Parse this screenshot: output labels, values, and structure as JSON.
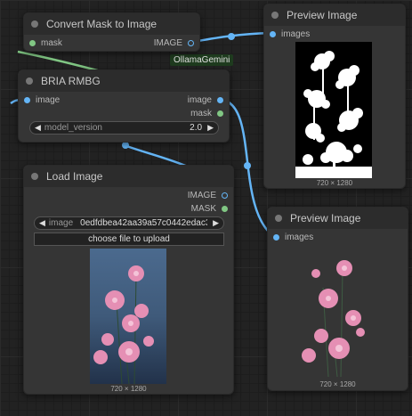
{
  "colors": {
    "image_link": "#64b5f6",
    "mask_link": "#81c784"
  },
  "link_label": "OllamaGemini",
  "nodes": {
    "convert_mask": {
      "title": "Convert Mask to Image",
      "input_mask": "mask",
      "output_image": "IMAGE"
    },
    "preview_top": {
      "title": "Preview Image",
      "input_images": "images",
      "caption": "720 × 1280"
    },
    "bria": {
      "title": "BRIA RMBG",
      "input_image": "image",
      "output_image": "image",
      "output_mask": "mask",
      "widget_label": "model_version",
      "widget_value": "2.0"
    },
    "load_image": {
      "title": "Load Image",
      "output_image": "IMAGE",
      "output_mask": "MASK",
      "widget_label": "image",
      "widget_value": "0edfdbea42aa39a57c0442edac3...",
      "upload_label": "choose file to upload",
      "caption": "720 × 1280"
    },
    "preview_bottom": {
      "title": "Preview Image",
      "input_images": "images",
      "caption": "720 × 1280"
    }
  },
  "icons": [
    "left-arrow-icon",
    "right-arrow-icon",
    "status-dot-icon"
  ]
}
